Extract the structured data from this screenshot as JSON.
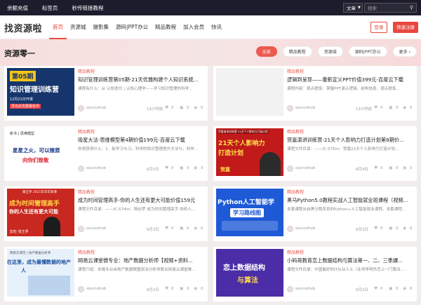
{
  "topbar": {
    "links": [
      "余额充值",
      "标签页",
      "秒传链接教程"
    ],
    "search_type": "文章",
    "search_placeholder": "搜索"
  },
  "header": {
    "logo": "找资源啦",
    "nav": [
      "首页",
      "资源城",
      "摄影集",
      "源码|PPT办公",
      "精品教程",
      "加入会员",
      "快讯"
    ],
    "login": "登录",
    "register": "快速注册"
  },
  "section": {
    "title": "资源零一",
    "filters": [
      "全部",
      "精品教程",
      "资源城",
      "源码|PPT办公",
      "更多"
    ]
  },
  "cards": [
    {
      "category": "精品教程",
      "title": "知识管理训练营第05期-21天优雅构建个人知识系统...",
      "desc": "课程有什么：从 认知迭代 | 认知心理学——学习知识管理的科学...",
      "author": "sourcehub",
      "date": "13小时前",
      "likes": "0",
      "comments": "0",
      "views": "0",
      "thumb_title": "第05期",
      "thumb_sub": "知识管理训练营",
      "thumb_date": "12月21日开课",
      "thumb_tag": "早鸟价优惠报名中"
    },
    {
      "category": "精品教程",
      "title": "逻辑到呈现——重新定义PPT价值399元-百度云下载",
      "desc": "课程内容：观点提炼：掌握PPT演示逻辑，结构信息，观点提炼...",
      "author": "sourcehub",
      "date": "13小时前",
      "likes": "0",
      "comments": "0",
      "views": "0"
    },
    {
      "category": "精品教程",
      "title": "吸星大法-思维模型第4期价值199元-百度云下载",
      "desc": "你将获得什么：1、新学习与习，科学的知识管理提升方法与，科学...",
      "author": "sourcehub",
      "date": "6月5日",
      "likes": "0",
      "comments": "0",
      "views": "3",
      "thumb_top": "新书 | 思维模型",
      "thumb_title": "星星之火，可以燎原",
      "thumb_sub": "向你们致敬"
    },
    {
      "category": "精品教程",
      "title": "贺嘉演讲训练营-21天个人影响力打造计划第8期价...",
      "desc": "课程文件目录：——/C-575m：贺嘉21天个人影响力打造计划...",
      "author": "sourcehub",
      "date": "6月4日",
      "likes": "0",
      "comments": "0",
      "views": "3",
      "thumb_top": "贺嘉演讲训练营·21天个人影响力打造计划",
      "thumb_title": "21天个人影响力",
      "thumb_sub": "打造计划",
      "thumb_name": "贺嘉"
    },
    {
      "category": "精品教程",
      "title": "成为时间管理高手-你的人生还有更大可能价值159元",
      "desc": "课程文件目录：——/C-574m：韩伙罗 成为时间管理高手-你的人...",
      "author": "sourcehub",
      "date": "6月3日",
      "likes": "0",
      "comments": "0",
      "views": "0",
      "thumb_top": "跟王罗 2021年年年新课",
      "thumb_title": "成为时间管理高手",
      "thumb_sub": "你的人生还有更大可能",
      "thumb_name": "彭旺 张王罗"
    },
    {
      "category": "精品教程",
      "title": "黑马Python5.0教程实战人工智能就业班课程（视频...",
      "desc": "本套课程出自黑马程序员的Python+人工智能就业课程，本套课程...",
      "author": "sourcehub",
      "date": "6月3日",
      "likes": "0",
      "comments": "0",
      "views": "6",
      "thumb_title": "Python人工智能学",
      "thumb_sub": "学习路线图"
    },
    {
      "category": "精品教程",
      "title": "网易云课堂微专业：地产数据分析师【视频+资料...",
      "desc": "课程介绍：本微专业由地产数据联盟资深分析师联合网易云课堂推...",
      "author": "sourcehub",
      "date": "6月2日",
      "likes": "0",
      "comments": "0",
      "views": "0",
      "thumb_top": "网易云课堂 | 地产数据分析师",
      "thumb_title": "在这里，成为最懂数据的地产",
      "thumb_sub": "人"
    },
    {
      "category": "精品教程",
      "title": "小码哥教育恋上数据结构与算法第一、二、三季課...",
      "desc": "课程文件目录：中国最好的IT从业人士（业师李明杰恋上一门算法...",
      "author": "sourcehub",
      "date": "6月2日",
      "likes": "0",
      "comments": "0",
      "views": "6",
      "thumb_title": "恋上数据结构",
      "thumb_sub": "与算法"
    }
  ]
}
